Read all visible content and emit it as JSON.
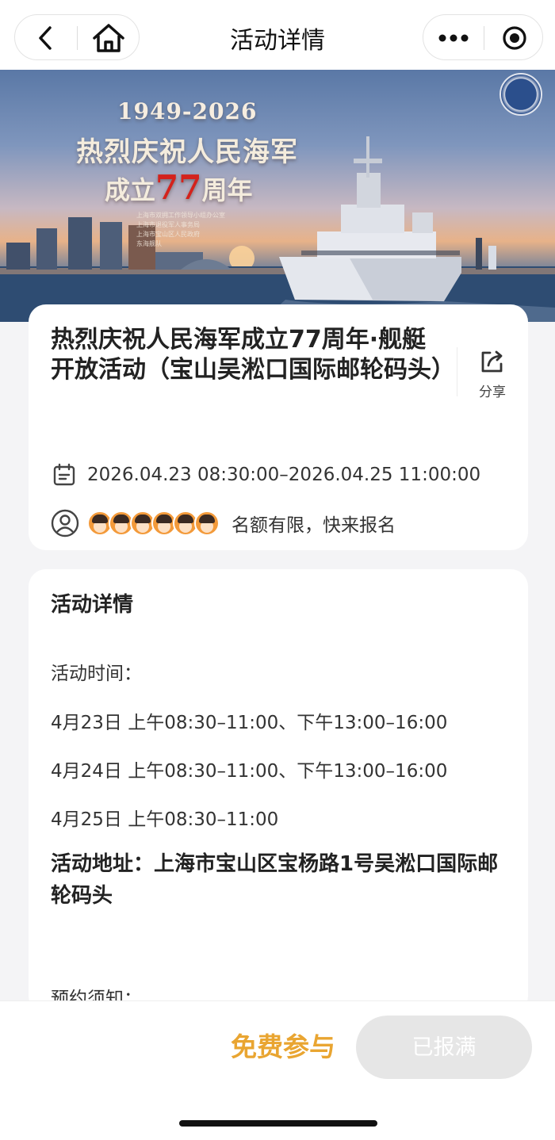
{
  "nav": {
    "title": "活动详情",
    "icons": [
      "back-icon",
      "home-icon",
      "more-icon",
      "close-icon"
    ]
  },
  "banner": {
    "years": "1949-2026",
    "headline": "热烈庆祝人民海军",
    "line3_prefix": "成立",
    "line3_number": "77",
    "line3_suffix": "周年",
    "small_text": [
      "上海市双拥工作领导小组办公室",
      "上海市退役军人事务局",
      "上海市宝山区人民政府",
      "东海舰队"
    ]
  },
  "event": {
    "title": "热烈庆祝人民海军成立77周年·舰艇开放活动（宝山吴淞口国际邮轮码头）",
    "share_label": "分享",
    "datetime": "2026.04.23 08:30:00–2026.04.25 11:00:00",
    "attendee_count_shown": 6,
    "attendee_note": "名额有限，快来报名"
  },
  "details": {
    "heading": "活动详情",
    "time_label": "活动时间：",
    "schedule": [
      "4月23日 上午08:30–11:00、下午13:00–16:00",
      "4月24日 上午08:30–11:00、下午13:00–16:00",
      "4月25日 上午08:30–11:00"
    ],
    "address": "活动地址：上海市宝山区宝杨路1号吴淞口国际邮轮码头",
    "notice_label": "预约须知："
  },
  "footer": {
    "free_label": "免费参与",
    "full_label": "已报满"
  },
  "colors": {
    "accent": "#e9a531",
    "highlight_red": "#d4221c",
    "disabled_button": "#e6e6e6"
  }
}
